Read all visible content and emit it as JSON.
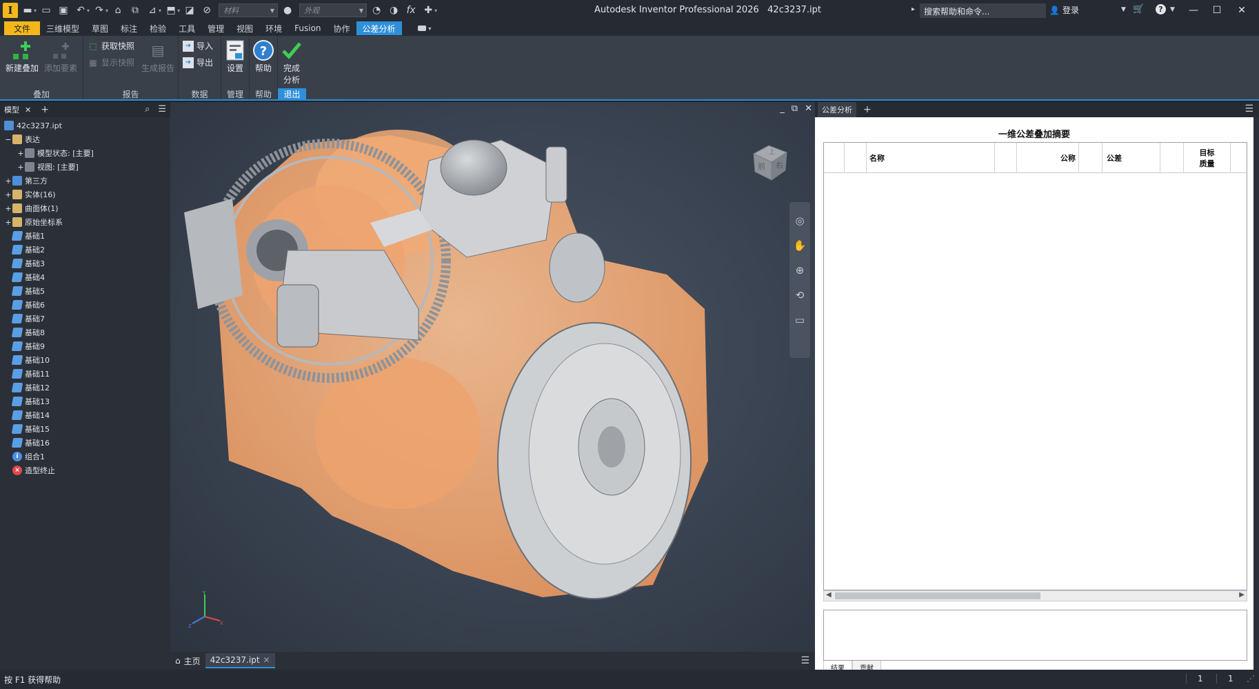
{
  "titlebar": {
    "app_title": "Autodesk Inventor Professional 2026",
    "file_name": "42c3237.ipt",
    "material_placeholder": "材料",
    "appearance_placeholder": "外观",
    "search_text": "搜索帮助和命令...",
    "login_label": "登录"
  },
  "ribbon_tabs": [
    "文件",
    "三维模型",
    "草图",
    "标注",
    "检验",
    "工具",
    "管理",
    "视图",
    "环境",
    "Fusion",
    "协作",
    "公差分析"
  ],
  "ribbon": {
    "new_stack": "新建叠加",
    "add_feature": "添加要素",
    "get_snapshot": "获取快照",
    "show_snapshot": "显示快照",
    "gen_report": "生成报告",
    "import": "导入",
    "export": "导出",
    "settings": "设置",
    "help": "帮助",
    "finish_line1": "完成",
    "finish_line2": "分析",
    "panel_stack": "叠加",
    "panel_report": "报告",
    "panel_data": "数据",
    "panel_manage": "管理",
    "panel_help": "帮助",
    "panel_exit": "退出"
  },
  "browser": {
    "tab_label": "模型",
    "root": "42c3237.ipt",
    "items": [
      {
        "label": "表达",
        "exp": "−",
        "indent": 0,
        "icon": "folder"
      },
      {
        "label": "模型状态: [主要]",
        "exp": "+",
        "indent": 1,
        "icon": "view"
      },
      {
        "label": "视图: [主要]",
        "exp": "+",
        "indent": 1,
        "icon": "view"
      },
      {
        "label": "第三方",
        "exp": "+",
        "indent": 0,
        "icon": "doc"
      },
      {
        "label": "实体(16)",
        "exp": "+",
        "indent": 0,
        "icon": "folder"
      },
      {
        "label": "曲面体(1)",
        "exp": "+",
        "indent": 0,
        "icon": "folder"
      },
      {
        "label": "原始坐标系",
        "exp": "+",
        "indent": 0,
        "icon": "folder"
      },
      {
        "label": "基础1",
        "exp": "",
        "indent": 0,
        "icon": "plane"
      },
      {
        "label": "基础2",
        "exp": "",
        "indent": 0,
        "icon": "plane"
      },
      {
        "label": "基础3",
        "exp": "",
        "indent": 0,
        "icon": "plane"
      },
      {
        "label": "基础4",
        "exp": "",
        "indent": 0,
        "icon": "plane"
      },
      {
        "label": "基础5",
        "exp": "",
        "indent": 0,
        "icon": "plane"
      },
      {
        "label": "基础6",
        "exp": "",
        "indent": 0,
        "icon": "plane"
      },
      {
        "label": "基础7",
        "exp": "",
        "indent": 0,
        "icon": "plane"
      },
      {
        "label": "基础8",
        "exp": "",
        "indent": 0,
        "icon": "plane"
      },
      {
        "label": "基础9",
        "exp": "",
        "indent": 0,
        "icon": "plane"
      },
      {
        "label": "基础10",
        "exp": "",
        "indent": 0,
        "icon": "plane"
      },
      {
        "label": "基础11",
        "exp": "",
        "indent": 0,
        "icon": "plane"
      },
      {
        "label": "基础12",
        "exp": "",
        "indent": 0,
        "icon": "plane"
      },
      {
        "label": "基础13",
        "exp": "",
        "indent": 0,
        "icon": "plane"
      },
      {
        "label": "基础14",
        "exp": "",
        "indent": 0,
        "icon": "plane"
      },
      {
        "label": "基础15",
        "exp": "",
        "indent": 0,
        "icon": "plane"
      },
      {
        "label": "基础16",
        "exp": "",
        "indent": 0,
        "icon": "plane"
      },
      {
        "label": "组合1",
        "exp": "",
        "indent": 0,
        "icon": "info"
      },
      {
        "label": "造型终止",
        "exp": "",
        "indent": 0,
        "icon": "err"
      }
    ]
  },
  "viewcube": {
    "front": "前",
    "right": "右",
    "top": "上"
  },
  "doc_tabs": {
    "home": "主页",
    "file": "42c3237.ipt"
  },
  "tolerance": {
    "tab_label": "公差分析",
    "title": "一维公差叠加摘要",
    "col_name": "名称",
    "col_nominal": "公称",
    "col_tolerance": "公差",
    "col_target1": "目标",
    "col_target2": "质量",
    "tab_result": "结果",
    "tab_contrib": "贡献"
  },
  "status": {
    "text": "按 F1 获得帮助",
    "n1": "1",
    "n2": "1"
  },
  "colors": {
    "accent": "#2f8fd8",
    "file_tab": "#f2b81b",
    "part_orange": "#f2ab78"
  }
}
